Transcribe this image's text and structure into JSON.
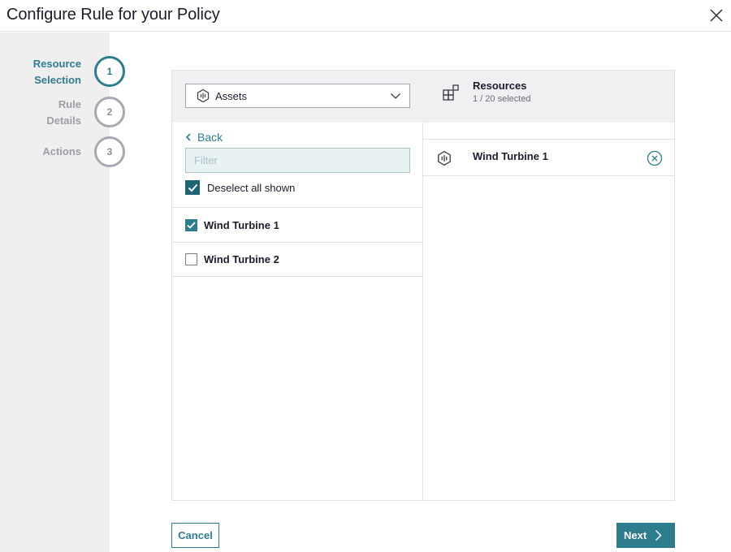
{
  "dialog": {
    "title": "Configure Rule for your Policy",
    "close_icon": "close-icon"
  },
  "stepper": {
    "steps": [
      {
        "label_line1": "Resource",
        "label_line2": "Selection",
        "number": "1",
        "state": "active"
      },
      {
        "label_line1": "Rule",
        "label_line2": "Details",
        "number": "2",
        "state": "inactive"
      },
      {
        "label_line1": "Actions",
        "label_line2": "",
        "number": "3",
        "state": "inactive"
      }
    ]
  },
  "left_panel": {
    "type_select": {
      "value": "Assets",
      "icon": "asset-hex-icon"
    },
    "back_label": "Back",
    "filter": {
      "value": "",
      "placeholder": "Filter"
    },
    "deselect_all_label": "Deselect all shown",
    "deselect_all_checked": true,
    "items": [
      {
        "label": "Wind Turbine 1",
        "checked": true
      },
      {
        "label": "Wind Turbine 2",
        "checked": false
      }
    ]
  },
  "right_panel": {
    "title": "Resources",
    "count": "1 / 20 selected",
    "icon": "resources-grid-icon",
    "selected": [
      {
        "label": "Wind Turbine 1",
        "icon": "asset-hex-icon"
      }
    ]
  },
  "footer": {
    "cancel_label": "Cancel",
    "next_label": "Next"
  },
  "colors": {
    "accent": "#2e7d8f",
    "accent_dark": "#1f6473",
    "stepper_bg": "#efeff0",
    "header_bg": "#f0f0f2"
  }
}
